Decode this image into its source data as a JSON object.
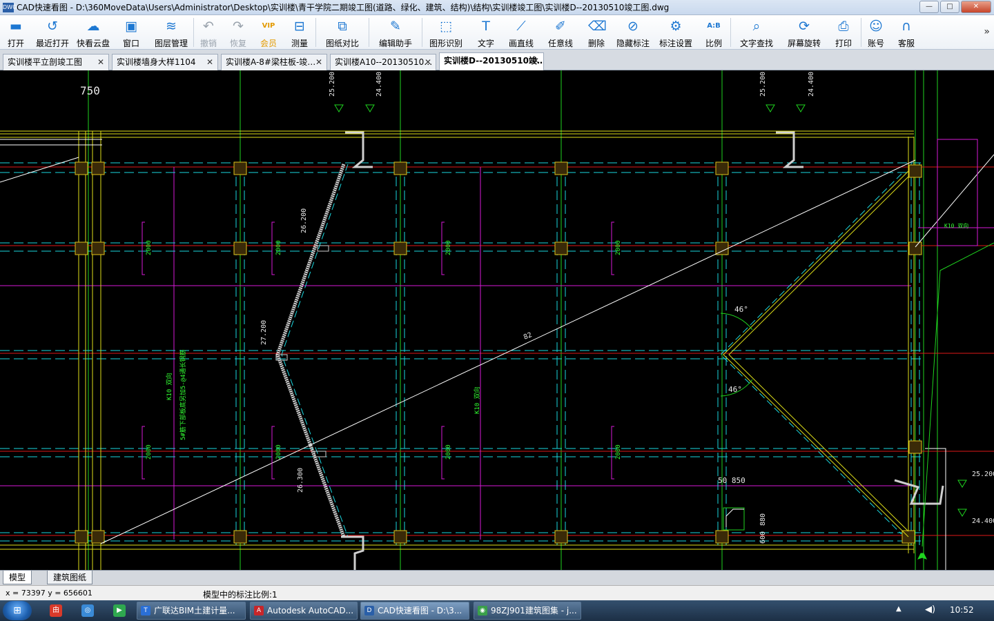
{
  "window": {
    "app_icon": "DWG",
    "title": "CAD快速看图 - D:\\360MoveData\\Users\\Administrator\\Desktop\\实训楼\\青干学院二期竣工图(道路、绿化、建筑、结构)\\结构\\实训楼竣工图\\实训楼D--20130510竣工图.dwg",
    "minimize": "—",
    "maximize": "□",
    "close": "✕"
  },
  "toolbar": {
    "items": [
      {
        "label": "打开",
        "icon": "folder-open-icon",
        "glyph": "▬"
      },
      {
        "label": "最近打开",
        "icon": "history-icon",
        "glyph": "↺"
      },
      {
        "label": "快看云盘",
        "icon": "cloud-icon",
        "glyph": "☁"
      },
      {
        "label": "窗口",
        "icon": "window-icon",
        "glyph": "▣"
      },
      {
        "label": "图层管理",
        "icon": "layers-icon",
        "glyph": "≋"
      },
      {
        "label": "撤销",
        "icon": "undo-icon",
        "glyph": "↶"
      },
      {
        "label": "恢复",
        "icon": "redo-icon",
        "glyph": "↷"
      },
      {
        "label": "会员",
        "icon": "vip-icon",
        "glyph": "VIP"
      },
      {
        "label": "测量",
        "icon": "ruler-icon",
        "glyph": "⊟"
      },
      {
        "label": "图纸对比",
        "icon": "compare-icon",
        "glyph": "⧉"
      },
      {
        "label": "编辑助手",
        "icon": "edit-assistant-icon",
        "glyph": "✎"
      },
      {
        "label": "图形识别",
        "icon": "shape-recognition-icon",
        "glyph": "⬚"
      },
      {
        "label": "文字",
        "icon": "text-icon",
        "glyph": "T"
      },
      {
        "label": "画直线",
        "icon": "line-icon",
        "glyph": "⟋"
      },
      {
        "label": "任意线",
        "icon": "pencil-icon",
        "glyph": "✐"
      },
      {
        "label": "删除",
        "icon": "eraser-icon",
        "glyph": "⌫"
      },
      {
        "label": "隐藏标注",
        "icon": "eye-hidden-icon",
        "glyph": "⊘"
      },
      {
        "label": "标注设置",
        "icon": "annotation-settings-icon",
        "glyph": "⚙"
      },
      {
        "label": "比例",
        "icon": "scale-icon",
        "glyph": "A:B"
      },
      {
        "label": "文字查找",
        "icon": "text-search-icon",
        "glyph": "⌕"
      },
      {
        "label": "屏幕旋转",
        "icon": "rotate-icon",
        "glyph": "⟳"
      },
      {
        "label": "打印",
        "icon": "printer-icon",
        "glyph": "⎙"
      },
      {
        "label": "账号",
        "icon": "user-icon",
        "glyph": "☺"
      },
      {
        "label": "客服",
        "icon": "headset-icon",
        "glyph": "∩"
      }
    ],
    "more": "»"
  },
  "doc_tabs": [
    {
      "label": "实训楼平立剖竣工图",
      "close": "✕"
    },
    {
      "label": "实训楼墙身大样1104",
      "close": "✕"
    },
    {
      "label": "实训楼A-8#梁柱板-竣…",
      "close": "✕"
    },
    {
      "label": "实训楼A10--20130510…",
      "close": "✕"
    },
    {
      "label": "实训楼D--20130510竣…",
      "close": "✕"
    }
  ],
  "drawing": {
    "texts": {
      "t750": "750",
      "t25200a": "25.200",
      "t24400a": "24.400",
      "t25200b": "25.200",
      "t24400b": "24.400",
      "t26200": "26.200",
      "t27200": "27.200",
      "t26300": "26.300",
      "t82": "82",
      "t46a": "46°",
      "t46b": "46°",
      "t50850": "50  850",
      "t880": "880",
      "t600": "600",
      "t25200c": "25.200",
      "t24400c": "24.400",
      "k10a": "K10 双向",
      "k10b": "K10 双向",
      "k10c": "K10 双向",
      "n2000": "2000",
      "note": "5#筋下部板底另加5-@4通长钢筋"
    }
  },
  "bottom_tabs": [
    {
      "label": "模型"
    },
    {
      "label": "建筑图纸"
    }
  ],
  "status": {
    "coords": "x = 73397  y = 656601",
    "scale": "模型中的标注比例:1"
  },
  "taskbar": {
    "start_glyph": "⊞",
    "quick_launch": [
      {
        "icon": "app-red-icon",
        "glyph": "由",
        "color": "#d93a2a"
      },
      {
        "icon": "browser-icon",
        "glyph": "◎",
        "color": "#3a8ad6"
      },
      {
        "icon": "media-player-icon",
        "glyph": "▶",
        "color": "#2fa84f"
      }
    ],
    "tasks": [
      {
        "label": "广联达BIM土建计量...",
        "icon": "glodon-icon",
        "glyph": "T",
        "color": "#2a6fd6"
      },
      {
        "label": "Autodesk AutoCAD...",
        "icon": "autocad-icon",
        "glyph": "A",
        "color": "#c8262a"
      },
      {
        "label": "CAD快速看图 - D:\\3...",
        "icon": "cad-viewer-icon",
        "glyph": "D",
        "color": "#2a5fa8"
      },
      {
        "label": "98ZJ901建筑图集 - j...",
        "icon": "chrome-icon",
        "glyph": "◉",
        "color": "#3aa04a"
      }
    ],
    "tray_up": "▲",
    "volume": "◀)",
    "clock": "10:52"
  }
}
